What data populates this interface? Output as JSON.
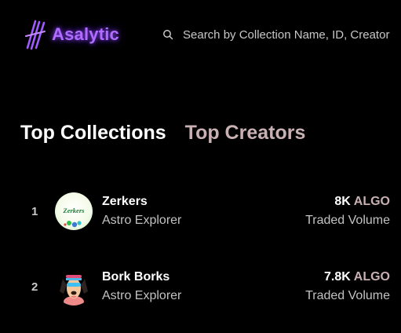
{
  "brand": {
    "name": "Asalytic",
    "color": "#b06cff",
    "icon": "asalytic-logo-icon"
  },
  "search": {
    "placeholder": "Search by Collection Name, ID, Creator",
    "icon": "search-icon"
  },
  "tabs": [
    {
      "label": "Top Collections",
      "active": true
    },
    {
      "label": "Top Creators",
      "active": false
    }
  ],
  "collections": [
    {
      "rank": "1",
      "name": "Zerkers",
      "creator": "Astro Explorer",
      "volume": "8K",
      "currency": "ALGO",
      "volume_label": "Traded Volume",
      "avatar_text": "Zerkers"
    },
    {
      "rank": "2",
      "name": "Bork Borks",
      "creator": "Astro Explorer",
      "volume": "7.8K",
      "currency": "ALGO",
      "volume_label": "Traded Volume"
    }
  ],
  "colors": {
    "background": "#000000",
    "muted_tab": "#c9b1b3",
    "secondary_text": "#c2c2c2"
  }
}
